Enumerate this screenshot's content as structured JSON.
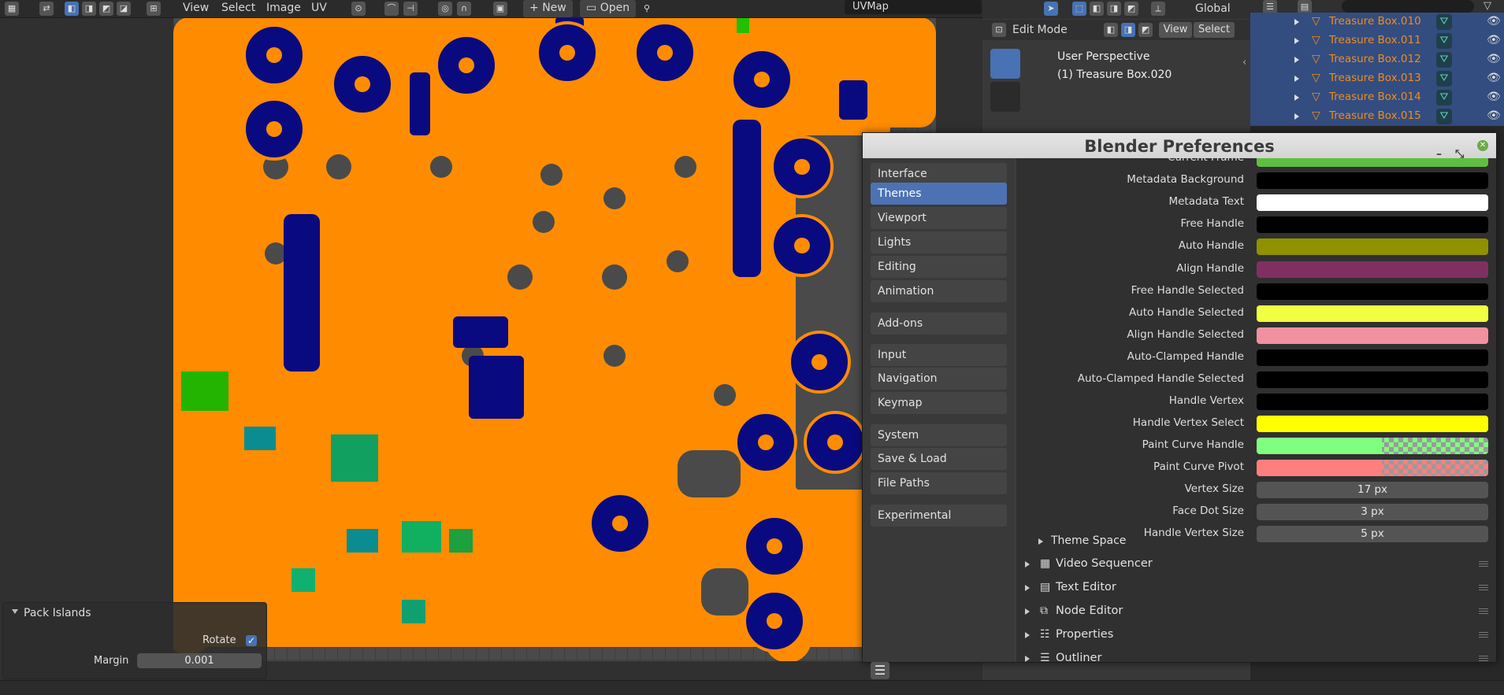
{
  "uv_editor": {
    "menu": {
      "view": "View",
      "select": "Select",
      "image": "Image",
      "uv": "UV",
      "new": "New",
      "open": "Open"
    },
    "uvmap": "UVMap"
  },
  "pack_islands": {
    "title": "Pack Islands",
    "rotate_label": "Rotate",
    "rotate_checked": true,
    "margin_label": "Margin",
    "margin_value": "0.001"
  },
  "viewport": {
    "transform": "Global",
    "mode": "Edit Mode",
    "view": "View",
    "select": "Select",
    "perspective": "User Perspective",
    "object": "(1) Treasure Box.020"
  },
  "outliner": {
    "items": [
      {
        "label": "Treasure Box.010"
      },
      {
        "label": "Treasure Box.011"
      },
      {
        "label": "Treasure Box.012"
      },
      {
        "label": "Treasure Box.013"
      },
      {
        "label": "Treasure Box.014"
      },
      {
        "label": "Treasure Box.015"
      }
    ]
  },
  "preferences": {
    "title": "Blender Preferences",
    "nav": {
      "interface": "Interface",
      "themes": "Themes",
      "viewport": "Viewport",
      "lights": "Lights",
      "editing": "Editing",
      "animation": "Animation",
      "addons": "Add-ons",
      "input": "Input",
      "navigation": "Navigation",
      "keymap": "Keymap",
      "system": "System",
      "save_load": "Save & Load",
      "file_paths": "File Paths",
      "experimental": "Experimental"
    },
    "active_nav": "Themes",
    "colors": [
      {
        "label": "Current Frame",
        "color": "#5fbf3f"
      },
      {
        "label": "Metadata Background",
        "color": "#000000"
      },
      {
        "label": "Metadata Text",
        "color": "#ffffff"
      },
      {
        "label": "Free Handle",
        "color": "#000000"
      },
      {
        "label": "Auto Handle",
        "color": "#909000"
      },
      {
        "label": "Align Handle",
        "color": "#803060"
      },
      {
        "label": "Free Handle Selected",
        "color": "#000000"
      },
      {
        "label": "Auto Handle Selected",
        "color": "#f0ff40"
      },
      {
        "label": "Align Handle Selected",
        "color": "#f090a0"
      },
      {
        "label": "Auto-Clamped Handle",
        "color": "#000000"
      },
      {
        "label": "Auto-Clamped Handle Selected",
        "color": "#000000"
      },
      {
        "label": "Handle Vertex",
        "color": "#000000"
      },
      {
        "label": "Handle Vertex Select",
        "color": "#ffff00"
      },
      {
        "label": "Paint Curve Handle",
        "color": "#7fff7f"
      },
      {
        "label": "Paint Curve Pivot",
        "color": "#ff7f7f"
      }
    ],
    "sizes": [
      {
        "label": "Vertex Size",
        "value": "17 px"
      },
      {
        "label": "Face Dot Size",
        "value": "3 px"
      },
      {
        "label": "Handle Vertex Size",
        "value": "5 px"
      }
    ],
    "subsection": "Theme Space",
    "sections": [
      {
        "label": "Video Sequencer",
        "icon": "film-icon"
      },
      {
        "label": "Text Editor",
        "icon": "text-editor-icon"
      },
      {
        "label": "Node Editor",
        "icon": "node-editor-icon"
      },
      {
        "label": "Properties",
        "icon": "properties-icon"
      },
      {
        "label": "Outliner",
        "icon": "outliner-icon"
      }
    ]
  },
  "colors": {
    "uv_orange": "#ff8c00",
    "uv_navy": "#0a0a80",
    "accent_blue": "#4772b3",
    "outliner_orange": "#f08c1c"
  }
}
